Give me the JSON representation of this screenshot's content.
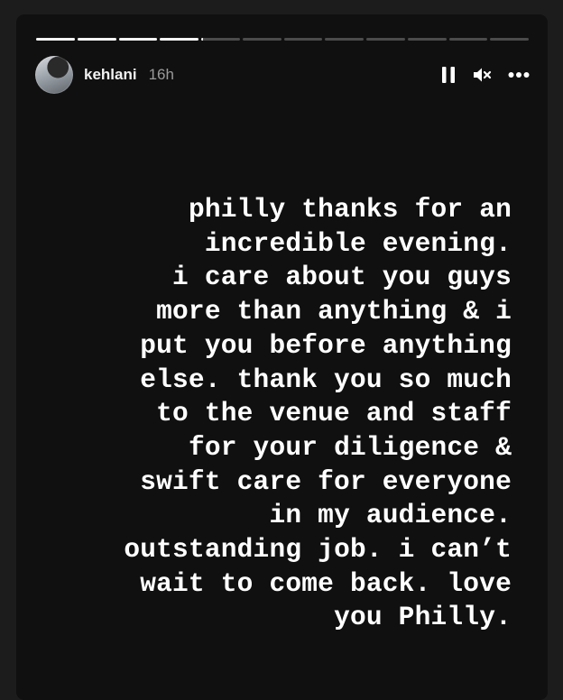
{
  "story": {
    "segments": [
      1,
      1,
      1,
      1,
      0.05,
      0,
      0,
      0,
      0,
      0,
      0,
      0
    ],
    "user": {
      "username": "kehlani",
      "timestamp": "16h"
    },
    "controls": {
      "pause_icon": "pause-icon",
      "mute_icon": "speaker-muted-icon",
      "more_icon": "more-horizontal-icon"
    },
    "caption_lines": [
      "philly thanks for an",
      "incredible evening.",
      "i care about you guys",
      "more than anything & i",
      "put you before anything",
      "else. thank you so much",
      "to the venue and staff",
      "for your diligence &",
      "swift care for everyone",
      "in my audience.",
      "outstanding job. i can’t",
      "wait to come back. love",
      "you Philly."
    ]
  }
}
